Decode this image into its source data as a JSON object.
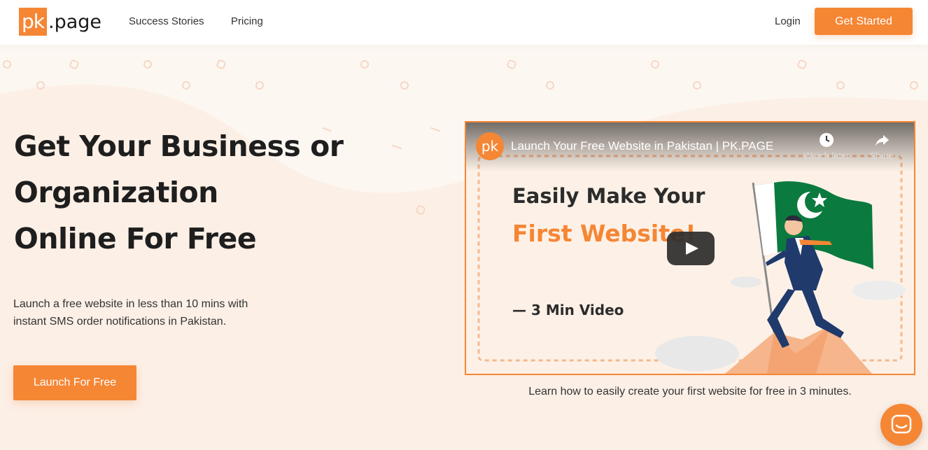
{
  "header": {
    "logo_mark": "pk",
    "logo_text": ".page",
    "nav": [
      {
        "label": "Success Stories"
      },
      {
        "label": "Pricing"
      }
    ],
    "login_label": "Login",
    "cta_label": "Get Started"
  },
  "hero": {
    "title_lines": [
      "Get Your Business or",
      "Organization",
      "Online For Free"
    ],
    "subtitle_lines": [
      "Launch a free website in less than 10 mins with",
      "instant SMS order notifications in Pakistan."
    ],
    "cta_label": "Launch For Free"
  },
  "video": {
    "channel_avatar": "pk",
    "title": "Launch Your Free Website in Pakistan | PK.PAGE",
    "watch_later_label": "Watch later",
    "share_label": "Share",
    "headline": "Easily Make Your",
    "headline_accent": "First Website!",
    "duration_label": "— 3 Min Video",
    "caption": "Learn how to easily create your first website for free in 3 minutes."
  },
  "colors": {
    "accent": "#f58634",
    "background": "#fdf7f2",
    "flag_green": "#0b7a3e"
  },
  "icons": {
    "clock": "clock-icon",
    "share": "share-arrow-icon",
    "play": "play-icon",
    "chat": "chat-bubble-icon"
  }
}
